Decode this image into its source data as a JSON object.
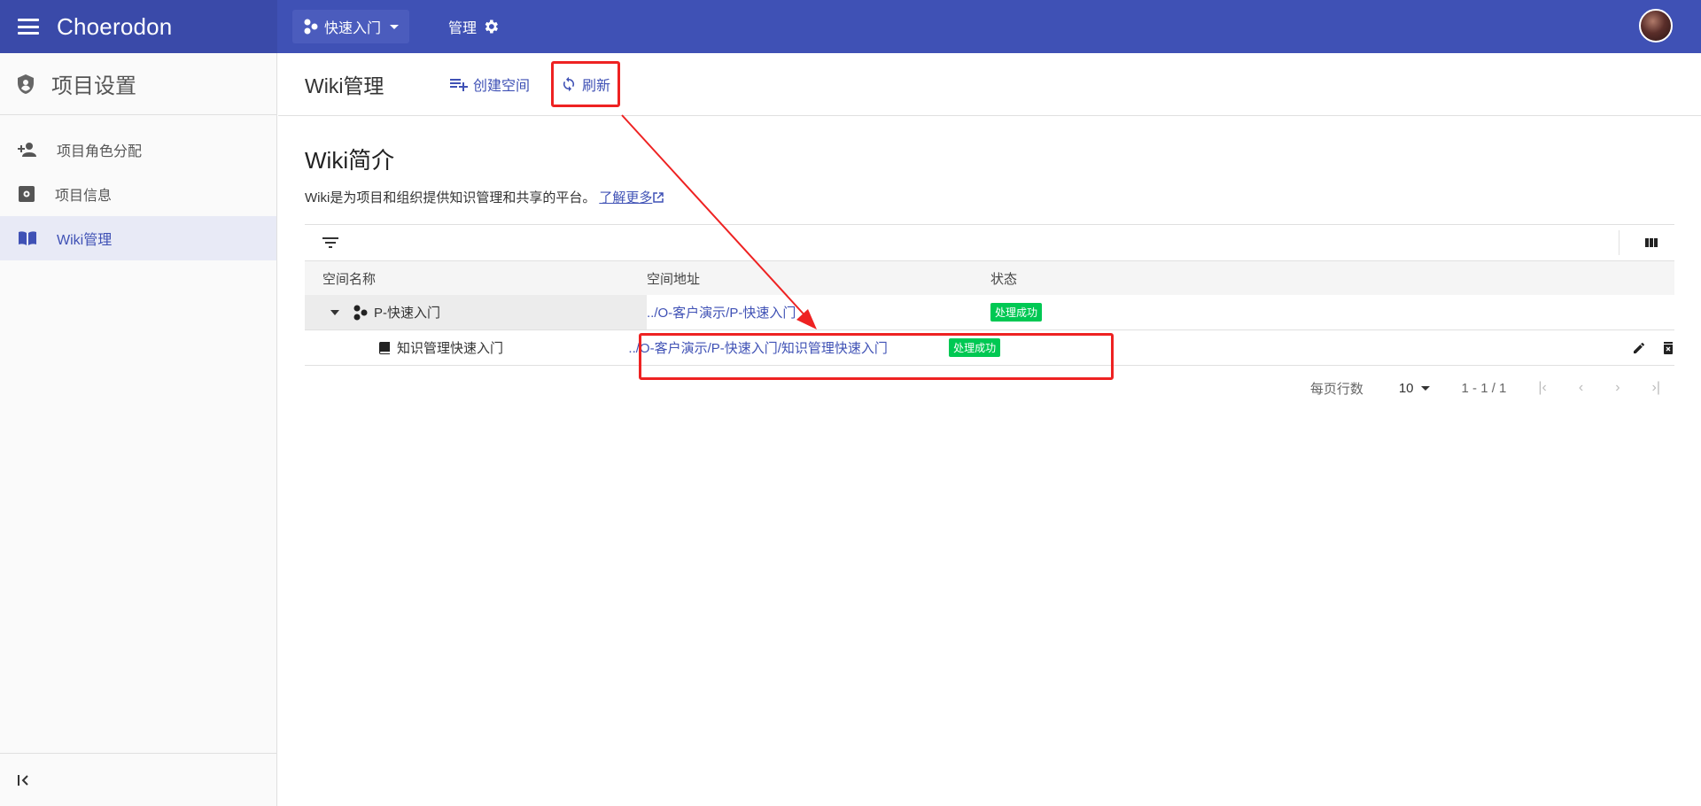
{
  "header": {
    "brand": "Choerodon",
    "project_switch": "快速入门",
    "manage": "管理"
  },
  "sidebar": {
    "title": "项目设置",
    "items": [
      {
        "label": "项目角色分配",
        "icon": "person-add-icon"
      },
      {
        "label": "项目信息",
        "icon": "project-info-icon"
      },
      {
        "label": "Wiki管理",
        "icon": "book-icon",
        "active": true
      }
    ]
  },
  "page": {
    "title": "Wiki管理",
    "create_space": "创建空间",
    "refresh": "刷新"
  },
  "intro": {
    "title": "Wiki简介",
    "desc": "Wiki是为项目和组织提供知识管理和共享的平台。",
    "learn_more": "了解更多"
  },
  "table": {
    "headers": [
      "空间名称",
      "空间地址",
      "状态"
    ],
    "rows": [
      {
        "name": "P-快速入门",
        "address": "../O-客户演示/P-快速入门",
        "status": "处理成功"
      },
      {
        "name": "知识管理快速入门",
        "address": "../O-客户演示/P-快速入门/知识管理快速入门",
        "status": "处理成功"
      }
    ]
  },
  "pager": {
    "rows_per_page_label": "每页行数",
    "page_size": "10",
    "range": "1 - 1 / 1"
  },
  "colors": {
    "primary": "#3f51b5",
    "success": "#00c853",
    "annotation": "#ee2222"
  }
}
